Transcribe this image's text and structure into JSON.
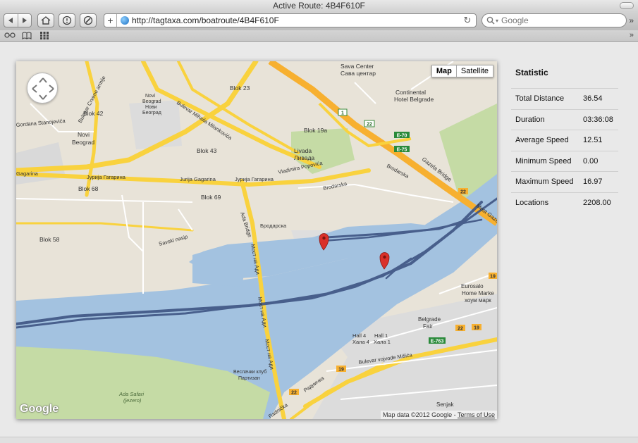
{
  "window": {
    "title": "Active Route: 4B4F610F"
  },
  "toolbar": {
    "url": "http://tagtaxa.com/boatroute/4B4F610F",
    "search_placeholder": "Google"
  },
  "map": {
    "type_buttons": [
      "Map",
      "Satellite"
    ],
    "active_type": "Map",
    "logo": "Google",
    "attribution": "Map data ©2012 Google",
    "attribution_link": "Terms of Use",
    "separator": " - ",
    "labels": {
      "sava_center": "Sava Center",
      "sava_center_cyr": "Сава центар",
      "continental": "Continental",
      "continental2": "Hotel Belgrade",
      "blok23": "Blok 23",
      "blok42": "Blok 42",
      "blok43": "Blok 43",
      "blok68": "Blok 68",
      "blok69": "Blok 69",
      "blok58": "Blok 58",
      "blok19a": "Blok 19a",
      "novi_beograd": "Novi",
      "novi_beograd2": "Beograd",
      "novi_beograd_small": "Novi",
      "novi_beograd_small2": "Beograd",
      "novi_beograd_small3": "Нови",
      "novi_beograd_small4": "Београд",
      "livada": "Livada",
      "livada_cyr": "Ливада",
      "bulevar_mm": "Bulevar Mihaila Milankovića",
      "bulevar_crvene": "Bulevar Crvene armije",
      "jurija": "Jurija Gagarina",
      "jurija_cyr": "Јурија Гагарина",
      "gagarina_left": "Gagarina",
      "gagarina_cyr_left": "Јурија Гагарина",
      "vladimira": "Vladimira Popovića",
      "brodarska": "Brodarska",
      "brodarska_cyr": "Бродарска",
      "savski_nasip": "Savski nasip",
      "ada_bridge": "Ada Bridge",
      "most_na_adi": "Мост на Ади",
      "gazela": "Gazela Bridge",
      "most_gazela": "Most Gazela",
      "eurosalon": "Eurosalo",
      "home_market": "Home Marke",
      "hom_cyr": "хоум марк",
      "belgrade_fair": "Belgrade",
      "belgrade_fair2": "Fair",
      "hall4": "Hall 4",
      "hall4_cyr": "Хала 4",
      "hall1": "Hall 1",
      "hall1_cyr": "Хала 1",
      "bulevar_vojvode": "Bulevar vojvode Mišića",
      "radnicka": "Radnička",
      "radnicka_cyr": "Радничка",
      "senjak": "Senjak",
      "sajam": "Seнjak",
      "ada_safari": "Ada Safari",
      "ada_safari2": "(jezero)",
      "veslacki": "Веслачки клуб",
      "veslacki2": "Партизан",
      "gordana": "Gordana Stanojevića",
      "road_1": "1",
      "road_22": "22",
      "e70": "E-70",
      "e75": "E-75",
      "road_22b": "22",
      "road_19": "19",
      "e763": "E-763",
      "road_19b": "19",
      "road_22c": "22",
      "road_22d": "22",
      "road_19c": "19"
    }
  },
  "statistic": {
    "title": "Statistic",
    "rows": [
      {
        "label": "Total Distance",
        "value": "36.54"
      },
      {
        "label": "Duration",
        "value": "03:36:08"
      },
      {
        "label": "Average Speed",
        "value": "12.51"
      },
      {
        "label": "Minimum Speed",
        "value": "0.00"
      },
      {
        "label": "Maximum Speed",
        "value": "16.97"
      },
      {
        "label": "Locations",
        "value": "2208.00"
      }
    ]
  },
  "colors": {
    "water": "#a3c2e0",
    "land": "#e8e3d8",
    "park": "#c5dba5",
    "highway": "#f9d23e",
    "motorway": "#f7b030",
    "route": "#3f5583",
    "marker": "#d9302a"
  },
  "icons": {
    "back": "back-arrow-icon",
    "forward": "forward-arrow-icon",
    "home": "home-icon",
    "history": "history-icon",
    "bookmarks": "book-icon"
  }
}
